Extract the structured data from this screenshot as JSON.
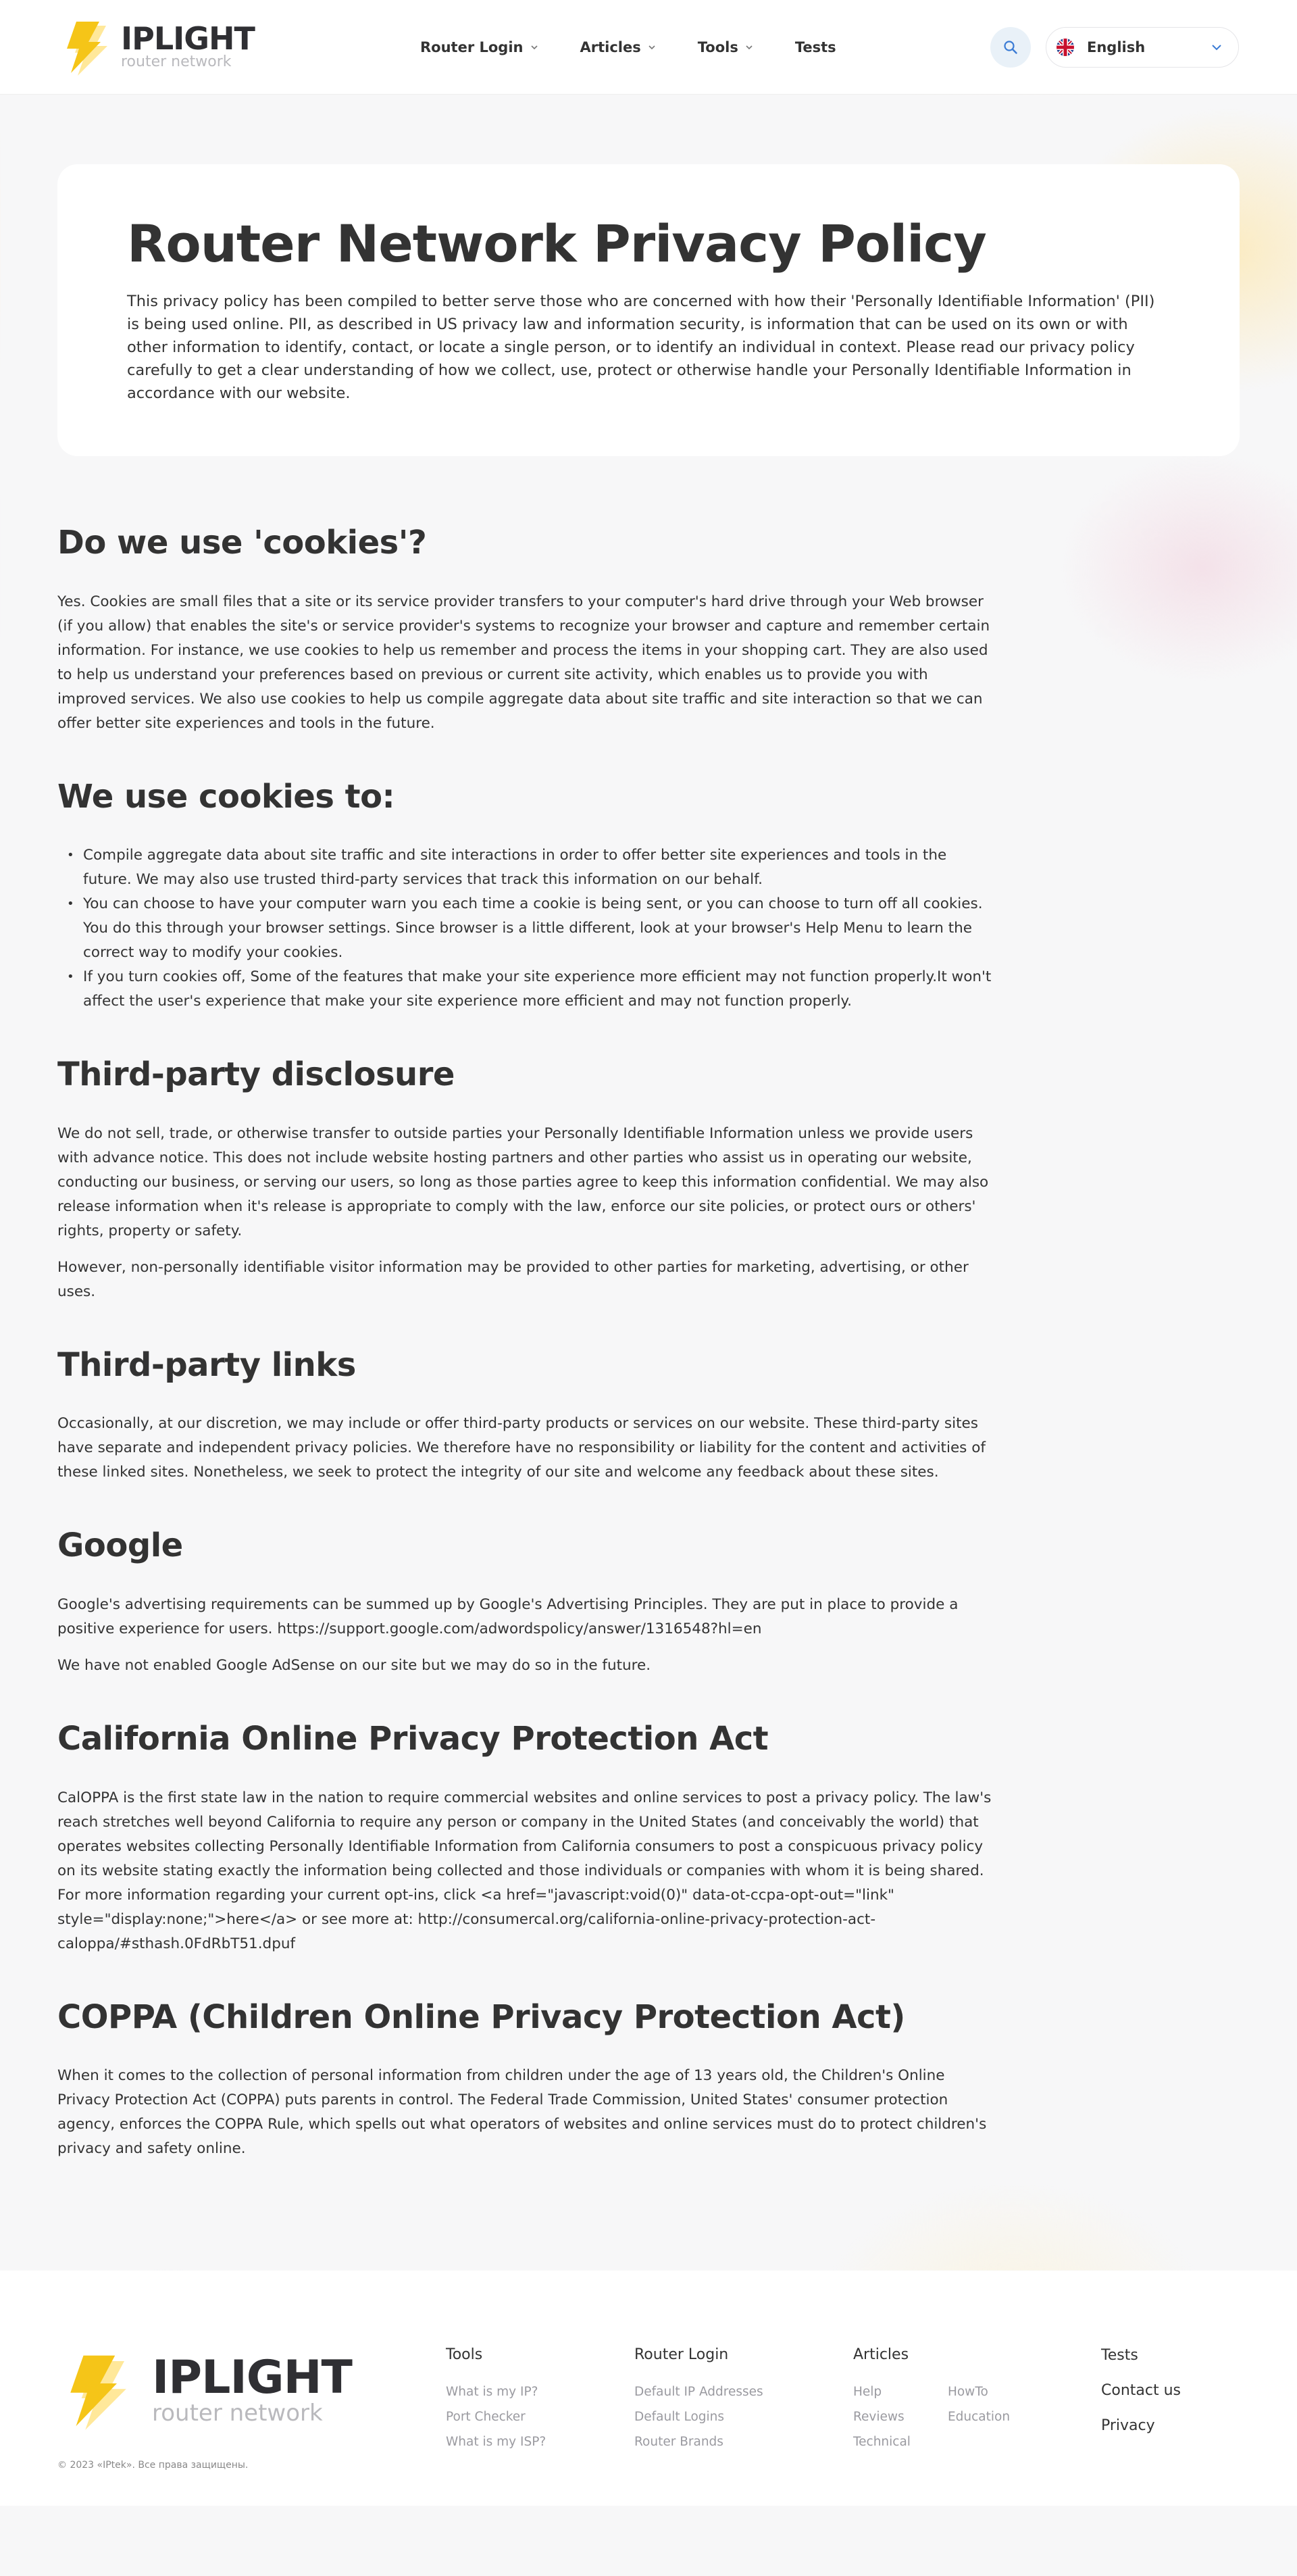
{
  "header": {
    "logo_title": "IPLIGHT",
    "logo_subtitle": "router network",
    "nav": [
      {
        "label": "Router Login"
      },
      {
        "label": "Articles"
      },
      {
        "label": "Tools"
      },
      {
        "label": "Tests"
      }
    ],
    "language": "English"
  },
  "colors": {
    "bolt_yellow": "#f5c518",
    "bolt_shadow": "#ffe89a",
    "accent_blue": "#3a7bd5",
    "text": "#333333"
  },
  "hero": {
    "title": "Router Network Privacy Policy",
    "text": "This privacy policy has been compiled to better serve those who are concerned with how their 'Personally Identifiable Information' (PII) is being used online. PII, as described in US privacy law and information security, is information that can be used on its own or with other information to identify, contact, or locate a single person, or to identify an individual in context. Please read our privacy policy carefully to get a clear understanding of how we collect, use, protect or otherwise handle your Personally Identifiable Information in accordance with our website."
  },
  "sections": {
    "cookies": {
      "title": "Do we use 'cookies'?",
      "p1": "Yes. Cookies are small files that a site or its service provider transfers to your computer's hard drive through your Web browser (if you allow) that enables the site's or service provider's systems to recognize your browser and capture and remember certain information. For instance, we use cookies to help us remember and process the items in your shopping cart. They are also used to help us understand your preferences based on previous or current site activity, which enables us to provide you with improved services. We also use cookies to help us compile aggregate data about site traffic and site interaction so that we can offer better site experiences and tools in the future."
    },
    "use_cookies": {
      "title": "We use cookies to:",
      "items": [
        "Compile aggregate data about site traffic and site interactions in order to offer better site experiences and tools in the future. We may also use trusted third-party services that track this information on our behalf.",
        "You can choose to have your computer warn you each time a cookie is being sent, or you can choose to turn off all cookies. You do this through your browser settings. Since browser is a little different, look at your browser's Help Menu to learn the correct way to modify your cookies.",
        "If you turn cookies off, Some of the features that make your site experience more efficient may not function properly.It won't affect the user's experience that make your site experience more efficient and may not function properly."
      ]
    },
    "third_party_disclosure": {
      "title": "Third-party disclosure",
      "p1": "We do not sell, trade, or otherwise transfer to outside parties your Personally Identifiable Information unless we provide users with advance notice. This does not include website hosting partners and other parties who assist us in operating our website, conducting our business, or serving our users, so long as those parties agree to keep this information confidential. We may also release information when it's release is appropriate to comply with the law, enforce our site policies, or protect ours or others' rights, property or safety.",
      "p2": "However, non-personally identifiable visitor information may be provided to other parties for marketing, advertising, or other uses."
    },
    "third_party_links": {
      "title": "Third-party links",
      "p1": "Occasionally, at our discretion, we may include or offer third-party products or services on our website. These third-party sites have separate and independent privacy policies. We therefore have no responsibility or liability for the content and activities of these linked sites. Nonetheless, we seek to protect the integrity of our site and welcome any feedback about these sites."
    },
    "google": {
      "title": "Google",
      "p1": "Google's advertising requirements can be summed up by Google's Advertising Principles. They are put in place to provide a positive experience for users. https://support.google.com/adwordspolicy/answer/1316548?hl=en",
      "p2": "We have not enabled Google AdSense on our site but we may do so in the future."
    },
    "caloppa": {
      "title": "California Online Privacy Protection Act",
      "p1": "CalOPPA is the first state law in the nation to require commercial websites and online services to post a privacy policy. The law's reach stretches well beyond California to require any person or company in the United States (and conceivably the world) that operates websites collecting Personally Identifiable Information from California consumers to post a conspicuous privacy policy on its website stating exactly the information being collected and those individuals or companies with whom it is being shared. For more information regarding your current opt-ins, click <a href=\"javascript:void(0)\" data-ot-ccpa-opt-out=\"link\" style=\"display:none;\">here</a> or see more at: http://consumercal.org/california-online-privacy-protection-act-caloppa/#sthash.0FdRbT51.dpuf"
    },
    "coppa": {
      "title": "COPPA (Children Online Privacy Protection Act)",
      "p1": "When it comes to the collection of personal information from children under the age of 13 years old, the Children's Online Privacy Protection Act (COPPA) puts parents in control. The Federal Trade Commission, United States' consumer protection agency, enforces the COPPA Rule, which spells out what operators of websites and online services must do to protect children's privacy and safety online."
    }
  },
  "footer": {
    "logo_title": "IPLIGHT",
    "logo_subtitle": "router network",
    "copyright": "© 2023 «IPtek». Все права защищены.",
    "tools": {
      "title": "Tools",
      "links": [
        "What is my IP?",
        "Port Checker",
        "What is my ISP?"
      ]
    },
    "router_login": {
      "title": "Router Login",
      "links": [
        "Default IP Addresses",
        "Default Logins",
        "Router Brands"
      ]
    },
    "articles": {
      "title": "Articles",
      "links_a": [
        "Help",
        "Reviews",
        "Technical"
      ],
      "links_b": [
        "HowTo",
        "Education"
      ]
    },
    "main_links": [
      "Tests",
      "Contact us",
      "Privacy"
    ]
  }
}
